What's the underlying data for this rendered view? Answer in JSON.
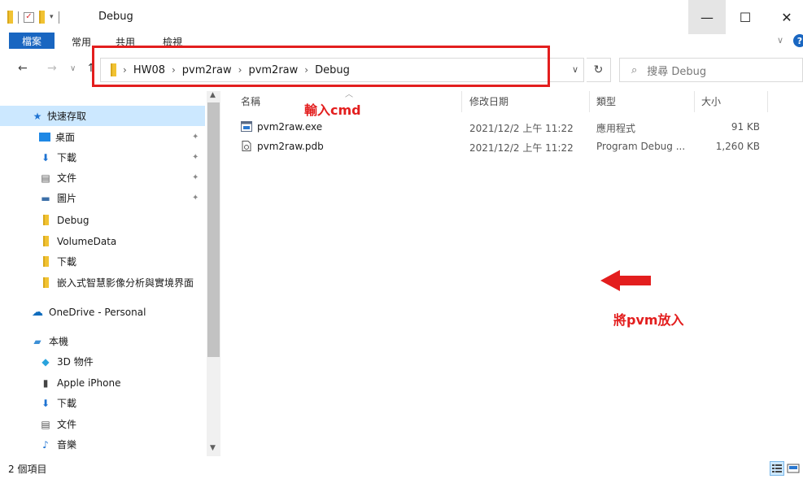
{
  "window": {
    "title": "Debug",
    "minimize_glyph": "—",
    "maximize_glyph": "☐",
    "close_glyph": "✕"
  },
  "ribbon": {
    "file_tab": "檔案",
    "tabs": [
      "常用",
      "共用",
      "檢視"
    ],
    "help_glyph": "?"
  },
  "nav": {
    "breadcrumbs": [
      "HW08",
      "pvm2raw",
      "pvm2raw",
      "Debug"
    ],
    "search_placeholder": "搜尋 Debug"
  },
  "sidebar": {
    "quick_access": "快速存取",
    "items": [
      {
        "label": "桌面",
        "icon": "desktop-icon",
        "pinned": true
      },
      {
        "label": "下載",
        "icon": "download-icon",
        "pinned": true
      },
      {
        "label": "文件",
        "icon": "document-icon",
        "pinned": true
      },
      {
        "label": "圖片",
        "icon": "pictures-icon",
        "pinned": true
      },
      {
        "label": "Debug",
        "icon": "folder-icon",
        "pinned": false
      },
      {
        "label": "VolumeData",
        "icon": "folder-icon",
        "pinned": false
      },
      {
        "label": "下載",
        "icon": "folder-icon",
        "pinned": false
      },
      {
        "label": "嵌入式智慧影像分析與實境界面",
        "icon": "folder-icon",
        "pinned": false
      }
    ],
    "onedrive": "OneDrive - Personal",
    "this_pc": "本機",
    "pc_items": [
      {
        "label": "3D 物件",
        "icon": "3d-objects-icon"
      },
      {
        "label": "Apple iPhone",
        "icon": "phone-icon"
      },
      {
        "label": "下載",
        "icon": "download-icon"
      },
      {
        "label": "文件",
        "icon": "document-icon"
      },
      {
        "label": "音樂",
        "icon": "music-icon"
      }
    ]
  },
  "columns": {
    "name": "名稱",
    "modified": "修改日期",
    "type": "類型",
    "size": "大小"
  },
  "files": [
    {
      "name": "pvm2raw.exe",
      "modified": "2021/12/2 上午 11:22",
      "type": "應用程式",
      "size": "91 KB",
      "icon": "exe-icon"
    },
    {
      "name": "pvm2raw.pdb",
      "modified": "2021/12/2 上午 11:22",
      "type": "Program Debug ...",
      "size": "1,260 KB",
      "icon": "pdb-icon"
    }
  ],
  "annotations": {
    "cmd": "輸入cmd",
    "pvm": "將pvm放入",
    "color": "#e31e1e"
  },
  "status": {
    "count": "2 個項目"
  }
}
